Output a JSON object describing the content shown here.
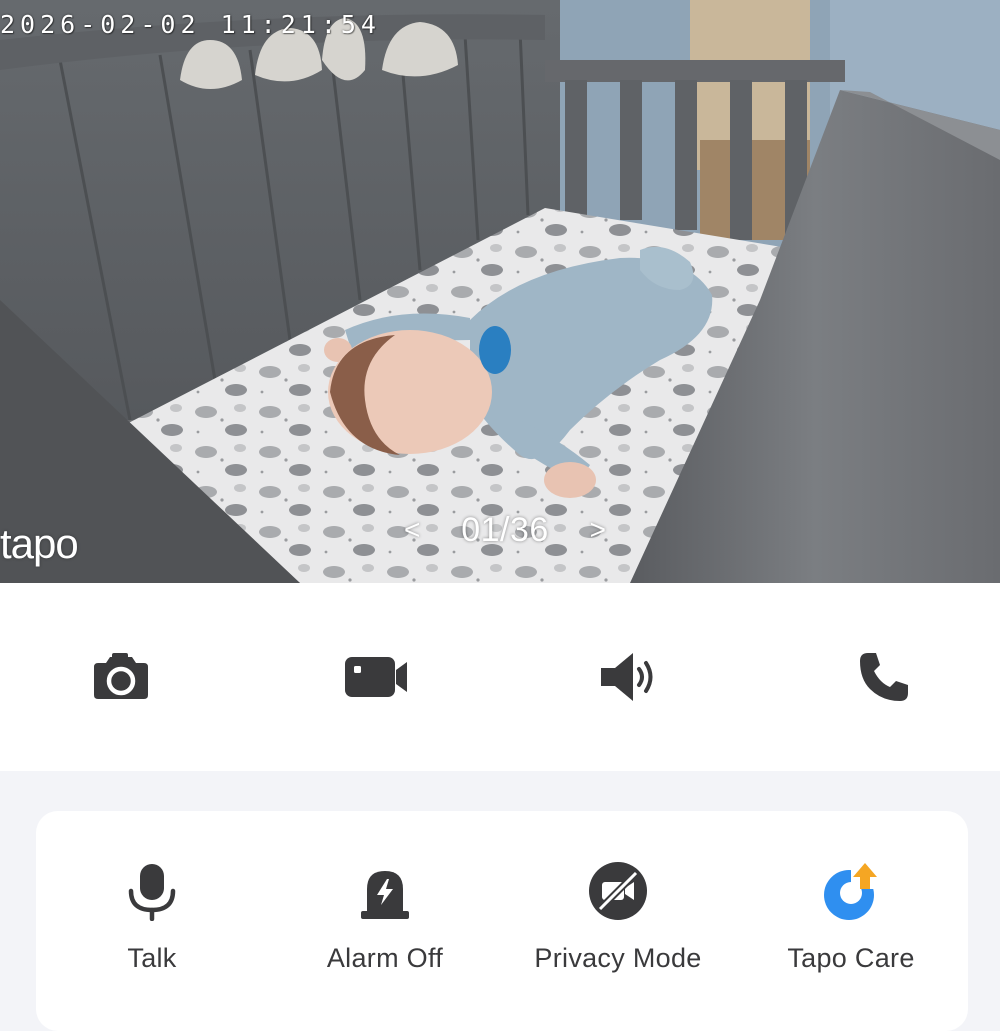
{
  "camera": {
    "timestamp": "2026-02-02 11:21:54",
    "watermark": "tapo",
    "pager": {
      "prev": "<",
      "count": "01/36",
      "next": ">"
    }
  },
  "quick_actions": [
    {
      "name": "snapshot",
      "icon": "camera-icon"
    },
    {
      "name": "record",
      "icon": "video-camera-icon"
    },
    {
      "name": "sound",
      "icon": "speaker-icon"
    },
    {
      "name": "call",
      "icon": "phone-icon"
    }
  ],
  "features": [
    {
      "label": "Talk",
      "icon": "microphone-icon"
    },
    {
      "label": "Alarm Off",
      "icon": "alarm-icon"
    },
    {
      "label": "Privacy Mode",
      "icon": "privacy-mode-icon"
    },
    {
      "label": "Tapo Care",
      "icon": "tapo-care-icon"
    }
  ],
  "colors": {
    "icon": "#3a3a3c",
    "accent_blue": "#2f8ff0",
    "accent_orange": "#f5a623",
    "page_background": "#f3f4f8"
  }
}
